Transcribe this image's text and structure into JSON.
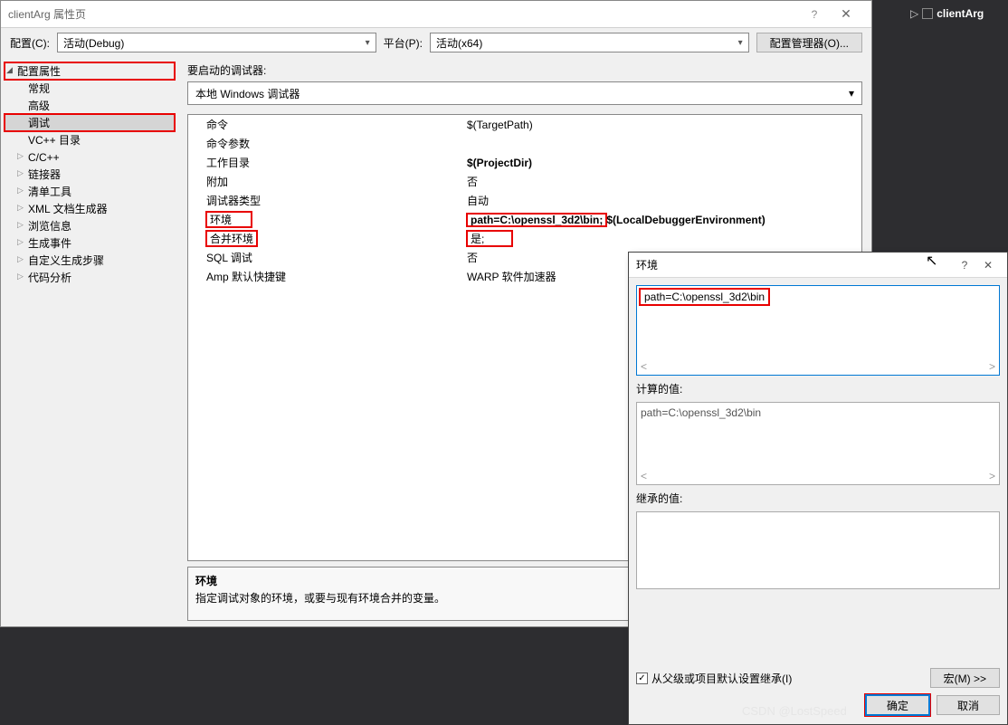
{
  "window": {
    "title": "clientArg 属性页",
    "help": "?",
    "close": "✕"
  },
  "toolbar": {
    "config_label": "配置(C):",
    "config_value": "活动(Debug)",
    "platform_label": "平台(P):",
    "platform_value": "活动(x64)",
    "manager_btn": "配置管理器(O)..."
  },
  "tree": {
    "root": "配置属性",
    "items": [
      {
        "label": "常规",
        "exp": false
      },
      {
        "label": "高级",
        "exp": false
      },
      {
        "label": "调试",
        "exp": false,
        "selected": true,
        "highlight": true
      },
      {
        "label": "VC++ 目录",
        "exp": false
      },
      {
        "label": "C/C++",
        "exp": true
      },
      {
        "label": "链接器",
        "exp": true
      },
      {
        "label": "清单工具",
        "exp": true
      },
      {
        "label": "XML 文档生成器",
        "exp": true
      },
      {
        "label": "浏览信息",
        "exp": true
      },
      {
        "label": "生成事件",
        "exp": true
      },
      {
        "label": "自定义生成步骤",
        "exp": true
      },
      {
        "label": "代码分析",
        "exp": true
      }
    ]
  },
  "content": {
    "launch_label": "要启动的调试器:",
    "debugger": "本地 Windows 调试器",
    "props": [
      {
        "name": "命令",
        "value": "$(TargetPath)"
      },
      {
        "name": "命令参数",
        "value": ""
      },
      {
        "name": "工作目录",
        "value": "$(ProjectDir)",
        "bold": true
      },
      {
        "name": "附加",
        "value": "否"
      },
      {
        "name": "调试器类型",
        "value": "自动"
      },
      {
        "name": "环境",
        "value": "path=C:\\openssl_3d2\\bin;$(LocalDebuggerEnvironment)",
        "hl_name": true,
        "hl_val": true,
        "bold": true
      },
      {
        "name": "合并环境",
        "value": "是",
        "hl_name": true,
        "hl_val": true
      },
      {
        "name": "SQL 调试",
        "value": "否"
      },
      {
        "name": "Amp 默认快捷键",
        "value": "WARP 软件加速器"
      }
    ],
    "desc": {
      "title": "环境",
      "text": "指定调试对象的环境，或要与现有环境合并的变量。"
    }
  },
  "env_dialog": {
    "title": "环境",
    "help": "?",
    "close": "✕",
    "input": "path=C:\\openssl_3d2\\bin",
    "computed_label": "计算的值:",
    "computed_value": "path=C:\\openssl_3d2\\bin",
    "inherited_label": "继承的值:",
    "inherit_checkbox": "从父级或项目默认设置继承(I)",
    "macros_btn": "宏(M) >>",
    "ok": "确定",
    "cancel": "取消"
  },
  "side": {
    "project": "clientArg"
  },
  "watermark": "CSDN @LostSpeed"
}
